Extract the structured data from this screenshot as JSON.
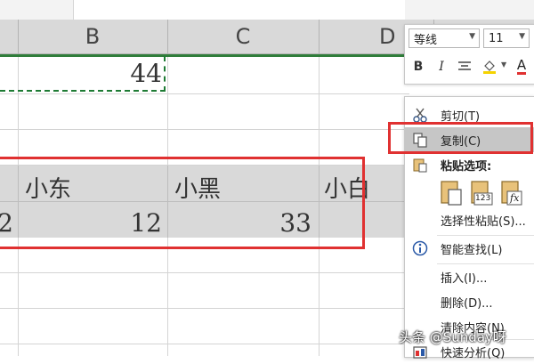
{
  "columns": [
    "B",
    "C",
    "D"
  ],
  "cells": {
    "b_top_value": "44",
    "header_row": [
      "小东",
      "小黑",
      "小白"
    ],
    "data_row": [
      "2",
      "12",
      "33"
    ]
  },
  "mini_toolbar": {
    "font_name": "等线",
    "font_size": "11",
    "bold": "B",
    "italic": "I",
    "font_color_letter": "A"
  },
  "context_menu": {
    "items": [
      {
        "label": "剪切(T)",
        "icon": "scissors-icon"
      },
      {
        "label": "复制(C)",
        "icon": "copy-icon"
      },
      {
        "label": "粘贴选项:",
        "icon": "paste-icon"
      },
      {
        "label": "选择性粘贴(S)...",
        "icon": ""
      },
      {
        "label": "智能查找(L)",
        "icon": "info-icon"
      },
      {
        "label": "插入(I)...",
        "icon": ""
      },
      {
        "label": "删除(D)...",
        "icon": ""
      },
      {
        "label": "清除内容(N)",
        "icon": ""
      },
      {
        "label": "快速分析(Q)",
        "icon": "quick-analysis-icon"
      }
    ],
    "paste_option_labels": [
      "123",
      "fx"
    ]
  },
  "colors": {
    "selection_border": "#e03131",
    "copy_marquee": "#1e7b34",
    "header_gray": "#d9d9d9",
    "menu_highlight": "#c6c6c6"
  },
  "watermark": "头条 @Sunday呀"
}
